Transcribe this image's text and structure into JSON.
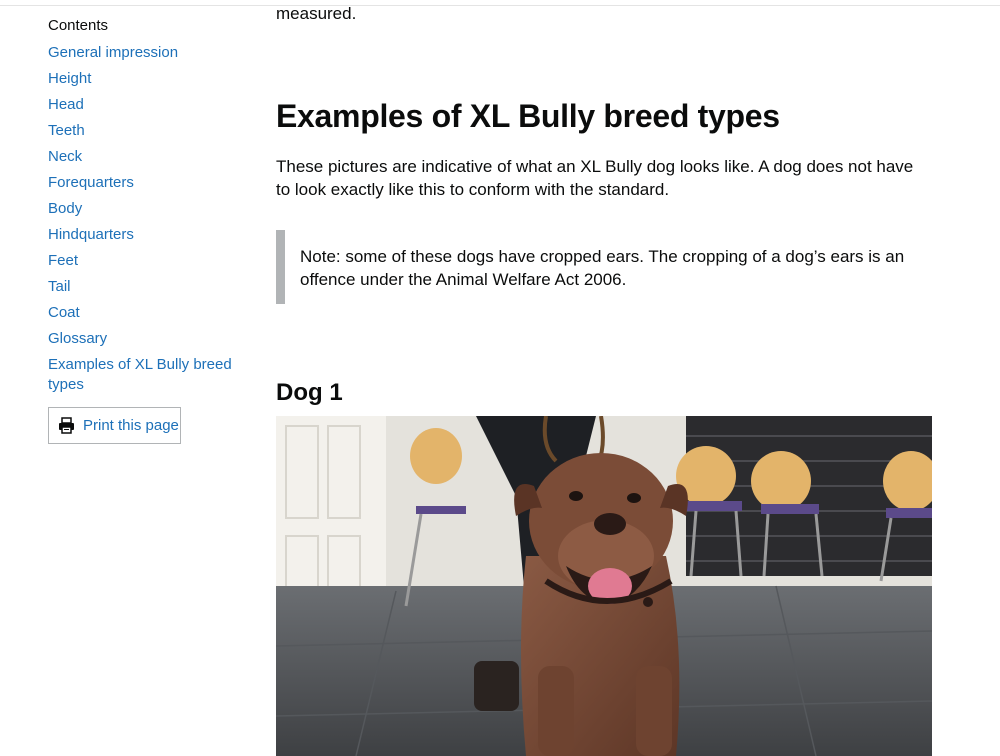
{
  "sidebar": {
    "contents_title": "Contents",
    "items": [
      {
        "label": "General impression"
      },
      {
        "label": "Height"
      },
      {
        "label": "Head"
      },
      {
        "label": "Teeth"
      },
      {
        "label": "Neck"
      },
      {
        "label": "Forequarters"
      },
      {
        "label": "Body"
      },
      {
        "label": "Hindquarters"
      },
      {
        "label": "Feet"
      },
      {
        "label": "Tail"
      },
      {
        "label": "Coat"
      },
      {
        "label": "Glossary"
      },
      {
        "label": "Examples of XL Bully breed types"
      }
    ],
    "print_button": {
      "label": "Print this page",
      "icon": "printer-icon"
    }
  },
  "main": {
    "prev_fragment": "measured.",
    "heading": "Examples of XL Bully breed types",
    "intro": "These pictures are indicative of what an XL Bully dog looks like. A dog does not have to look exactly like this to conform with the standard.",
    "inset_note": "Note: some of these dogs have cropped ears. The cropping of a dog’s ears is an offence under the Animal Welfare Act 2006.",
    "subheading": "Dog 1"
  },
  "colors": {
    "link": "#1d70b8",
    "text": "#0b0c0c",
    "inset_border": "#b1b4b6"
  }
}
